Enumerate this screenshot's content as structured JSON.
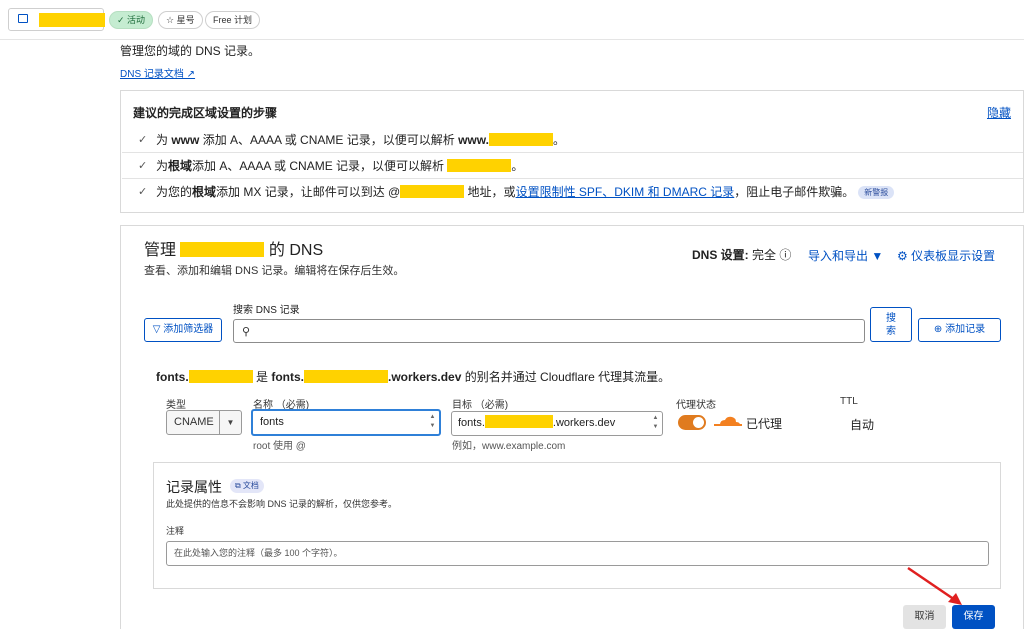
{
  "topbar": {
    "status_badge": "✓ 活动",
    "star_badge": "☆ 星号",
    "plan_badge": "Free 计划"
  },
  "intro": {
    "text": "管理您的域的 DNS 记录。",
    "doc_link": "DNS 记录文档 ↗"
  },
  "suggestions": {
    "title": "建议的完成区域设置的步骤",
    "hide": "隐藏",
    "row1": {
      "prefix": "为 ",
      "bold1": "www",
      "mid": " 添加 A、AAAA 或 CNAME 记录，以便可以解析 ",
      "bold2": "www.",
      "suffix": "。"
    },
    "row2": {
      "prefix": "为",
      "bold1": "根域",
      "mid": "添加 A、AAAA 或 CNAME 记录，以便可以解析 ",
      "suffix": "。"
    },
    "row3": {
      "prefix": "为您的",
      "bold1": "根域",
      "mid": "添加 MX 记录，让邮件可以到达 @",
      "mid2": " 地址，或",
      "link": "设置限制性 SPF、DKIM 和 DMARC 记录",
      "suffix": "，阻止电子邮件欺骗。",
      "badge": "新警报"
    }
  },
  "manage": {
    "title_prefix": "管理",
    "title_suffix": "的 DNS",
    "subtitle": "查看、添加和编辑 DNS 记录。编辑将在保存后生效。",
    "dns_settings_label": "DNS 设置:",
    "dns_settings_value": "完全 ⓘ",
    "import_export": "导入和导出 ▼",
    "dashboard_settings": "⚙ 仪表板显示设置",
    "filter_button": "▽ 添加筛选器",
    "search_label": "搜索 DNS 记录",
    "search_button": "搜\n索",
    "add_record_button": "⊕ 添加记录"
  },
  "record": {
    "info_prefix": "fonts.",
    "info_mid": " 是 ",
    "info_bold_prefix": "fonts.",
    "info_bold_suffix": ".workers.dev",
    "info_suffix": " 的别名并通过 Cloudflare 代理其流量。",
    "type_label": "类型",
    "type_value": "CNAME",
    "name_label": "名称 （必需)",
    "name_value": "fonts",
    "name_hint": "root 使用 @",
    "target_label": "目标 （必需)",
    "target_prefix": "fonts.",
    "target_suffix": ".workers.dev",
    "target_hint": "例如，www.example.com",
    "proxy_label": "代理状态",
    "proxy_value": "已代理",
    "ttl_label": "TTL",
    "ttl_value": "自动"
  },
  "properties": {
    "title": "记录属性",
    "doc_badge": "⧉ 文档",
    "subtitle": "此处提供的信息不会影响 DNS 记录的解析，仅供您参考。",
    "note_label": "注释",
    "note_placeholder": "在此处输入您的注释（最多 100 个字符）。"
  },
  "actions": {
    "cancel": "取消",
    "save": "保存"
  },
  "colors": {
    "accent": "#0051c3",
    "proxy_orange": "#e07b1f",
    "redaction": "#ffd200",
    "annotation_arrow": "#e02020"
  }
}
